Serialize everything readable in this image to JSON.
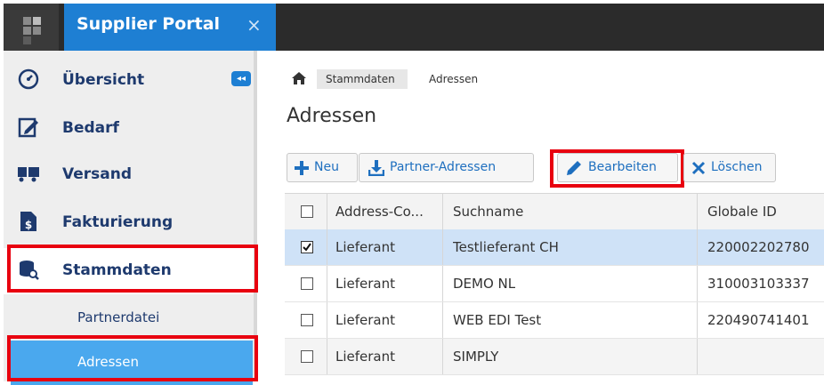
{
  "window": {
    "tab_title": "Supplier Portal",
    "close_glyph": "×"
  },
  "sidebar": {
    "collapse_glyph": "◂◂",
    "items": [
      {
        "label": "Übersicht",
        "icon": "dashboard-gauge-icon"
      },
      {
        "label": "Bedarf",
        "icon": "edit-document-icon"
      },
      {
        "label": "Versand",
        "icon": "truck-icon"
      },
      {
        "label": "Fakturierung",
        "icon": "invoice-dollar-icon"
      },
      {
        "label": "Stammdaten",
        "icon": "database-search-icon"
      }
    ],
    "sub_items": [
      {
        "label": "Partnerdatei"
      },
      {
        "label": "Adressen"
      }
    ]
  },
  "breadcrumb": {
    "home_icon": "home-icon",
    "items": [
      "Stammdaten",
      "Adressen"
    ]
  },
  "page": {
    "title": "Adressen"
  },
  "toolbar": {
    "new_label": "Neu",
    "partner_label": "Partner-Adressen",
    "edit_label": "Bearbeiten",
    "delete_label": "Löschen"
  },
  "table": {
    "columns": [
      "Address-Co...",
      "Suchname",
      "Globale ID"
    ],
    "rows": [
      {
        "checked": true,
        "type": "Lieferant",
        "name": "Testlieferant CH",
        "gid": "220002202780"
      },
      {
        "checked": false,
        "type": "Lieferant",
        "name": "DEMO NL",
        "gid": "310003103337"
      },
      {
        "checked": false,
        "type": "Lieferant",
        "name": "WEB EDI Test",
        "gid": "220490741401"
      },
      {
        "checked": false,
        "type": "Lieferant",
        "name": "SIMPLY",
        "gid": ""
      }
    ]
  },
  "colors": {
    "accent": "#1e7fd3",
    "highlight": "#e8000f",
    "nav_text": "#1e3a6e",
    "selected_row": "#cfe2f7"
  }
}
